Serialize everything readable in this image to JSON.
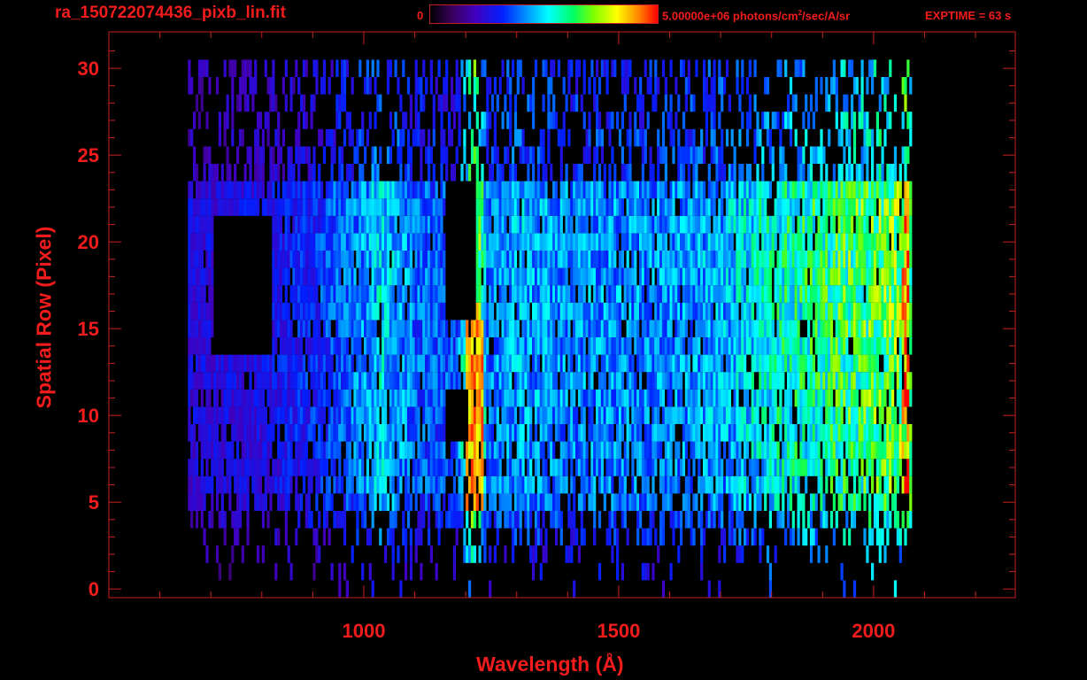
{
  "header": {
    "title": "ra_150722074436_pixb_lin.fit",
    "colorbar_min_label": "0",
    "colorbar_max_label": "5.00000e+06 photons/cm",
    "colorbar_max_sup": "2",
    "colorbar_max_unit_tail": "/sec/A/sr",
    "exptime": "EXPTIME = 63 s"
  },
  "colors": {
    "axis": "#f21c1c",
    "background": "#000000"
  },
  "chart_data": {
    "type": "heatmap",
    "title": "ra_150722074436_pixb_lin.fit",
    "xlabel": "Wavelength (Å)",
    "ylabel": "Spatial Row (Pixel)",
    "xlim": [
      500,
      2278
    ],
    "ylim": [
      -0.5,
      32.1
    ],
    "xticks": [
      1000,
      1500,
      2000
    ],
    "xtick_labels": [
      "1000",
      "1500",
      "2000"
    ],
    "yticks": [
      0,
      5,
      10,
      15,
      20,
      25,
      30
    ],
    "ytick_labels": [
      "0",
      "5",
      "10",
      "15",
      "20",
      "25",
      "30"
    ],
    "color_range": [
      0,
      5000000
    ],
    "colormap": "rainbow",
    "data_wavelength_range": [
      655,
      2075
    ],
    "rows": 31,
    "row_weights": [
      0.02,
      0.05,
      0.15,
      0.35,
      0.5,
      0.75,
      0.85,
      0.85,
      0.9,
      0.9,
      0.95,
      0.95,
      0.95,
      0.95,
      0.95,
      0.95,
      0.95,
      1.0,
      1.0,
      1.0,
      1.0,
      1.0,
      1.0,
      0.95,
      0.5,
      0.45,
      0.45,
      0.4,
      0.35,
      0.35,
      0.35
    ],
    "spectrum_fraction": [
      [
        655,
        0.25
      ],
      [
        800,
        0.27
      ],
      [
        900,
        0.32
      ],
      [
        1000,
        0.42
      ],
      [
        1030,
        0.5
      ],
      [
        1100,
        0.38
      ],
      [
        1180,
        0.36
      ],
      [
        1216,
        0.85
      ],
      [
        1240,
        0.4
      ],
      [
        1300,
        0.45
      ],
      [
        1400,
        0.42
      ],
      [
        1500,
        0.42
      ],
      [
        1600,
        0.42
      ],
      [
        1700,
        0.45
      ],
      [
        1800,
        0.55
      ],
      [
        1900,
        0.6
      ],
      [
        2000,
        0.66
      ],
      [
        2050,
        0.7
      ],
      [
        2065,
        0.98
      ],
      [
        2075,
        0.3
      ]
    ],
    "blank_regions": [
      {
        "wl": [
          1160,
          1215
        ],
        "rows": [
          16,
          23
        ]
      },
      {
        "wl": [
          1160,
          1200
        ],
        "rows": [
          9,
          11
        ]
      },
      {
        "wl": [
          705,
          815
        ],
        "rows": [
          14,
          21
        ]
      }
    ]
  },
  "axes": {
    "xlabel": "Wavelength (Å)",
    "ylabel": "Spatial Row (Pixel)",
    "xticks": [
      "1000",
      "1500",
      "2000"
    ],
    "yticks": [
      "0",
      "5",
      "10",
      "15",
      "20",
      "25",
      "30"
    ]
  }
}
